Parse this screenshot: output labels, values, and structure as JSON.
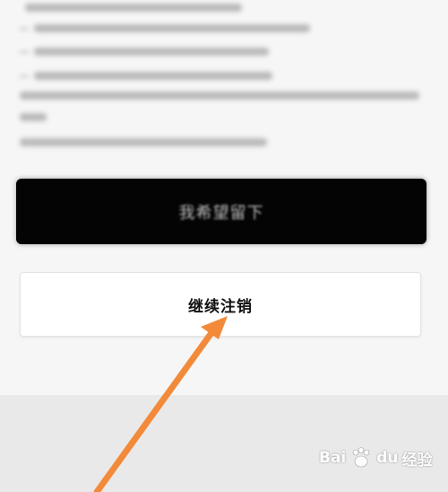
{
  "dialog": {
    "stay_button_label": "我希望留下",
    "continue_button_label": "继续注销"
  },
  "watermark": {
    "brand": "Bai",
    "brand_suffix": "du",
    "service": "经验"
  },
  "colors": {
    "stay_button_bg": "#040404",
    "continue_button_bg": "#ffffff",
    "arrow": "#f38a3a"
  },
  "icons": {
    "annotation": "arrow-icon",
    "watermark_logo": "baidu-paw-icon"
  }
}
